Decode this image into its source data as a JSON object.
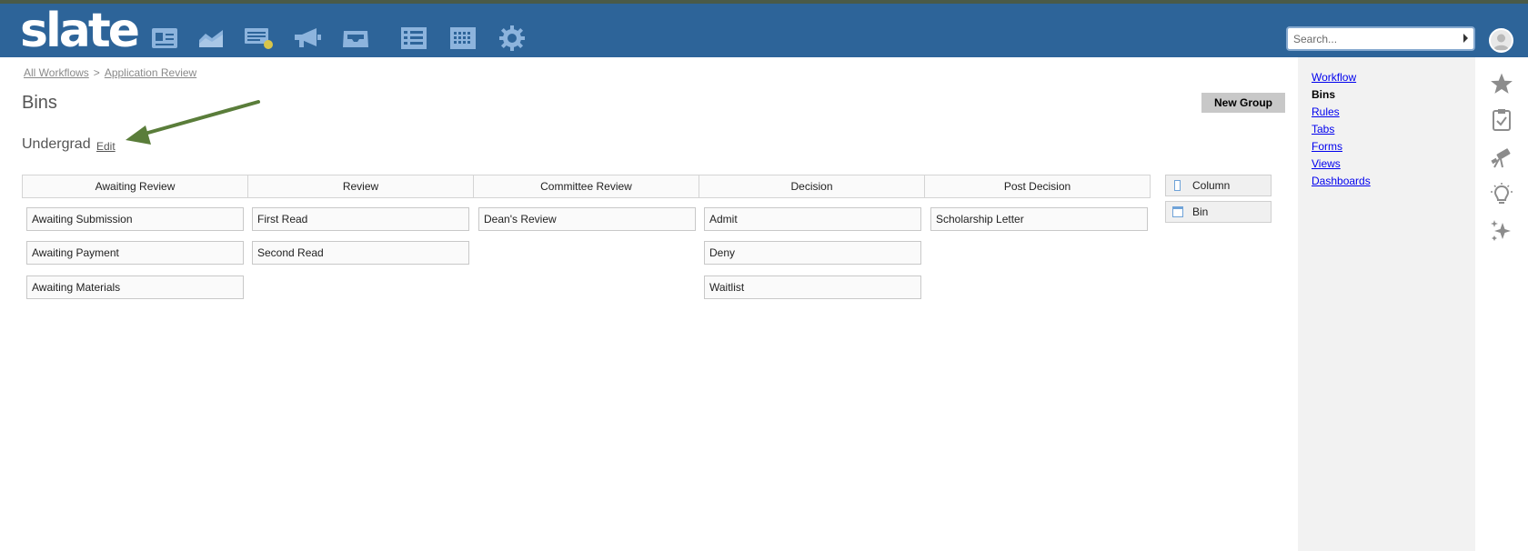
{
  "nav": {
    "logo": "slate",
    "icons": [
      "contact-card-icon",
      "chart-area-icon",
      "reader-icon",
      "megaphone-icon",
      "inbox-icon",
      "list-icon",
      "calendar-icon",
      "gear-icon"
    ]
  },
  "search": {
    "placeholder": "Search..."
  },
  "breadcrumb": {
    "items": [
      "All Workflows",
      "Application Review"
    ],
    "separator": ">"
  },
  "page": {
    "title": "Bins"
  },
  "group": {
    "name": "Undergrad",
    "edit_label": "Edit"
  },
  "toolbar": {
    "new_group_label": "New Group"
  },
  "columns": [
    {
      "title": "Awaiting Review",
      "bins": [
        "Awaiting Submission",
        "Awaiting Payment",
        "Awaiting Materials"
      ]
    },
    {
      "title": "Review",
      "bins": [
        "First Read",
        "Second Read"
      ]
    },
    {
      "title": "Committee Review",
      "bins": [
        "Dean's Review"
      ]
    },
    {
      "title": "Decision",
      "bins": [
        "Admit",
        "Deny",
        "Waitlist"
      ]
    },
    {
      "title": "Post Decision",
      "bins": [
        "Scholarship Letter"
      ]
    }
  ],
  "palette": {
    "column_label": "Column",
    "bin_label": "Bin"
  },
  "rightnav": {
    "items": [
      "Workflow",
      "Bins",
      "Rules",
      "Tabs",
      "Forms",
      "Views",
      "Dashboards"
    ],
    "active": "Bins"
  },
  "colors": {
    "navbar": "#2d6499",
    "icon": "#8db4dd",
    "arrow": "#5a7d3a",
    "panel": "#f2f2f2"
  }
}
